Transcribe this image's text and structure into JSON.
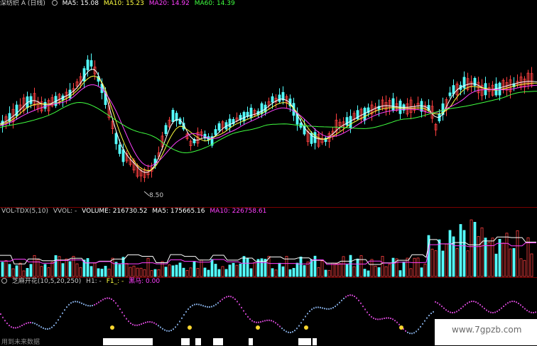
{
  "colors": {
    "up": "#ff4040",
    "down": "#54ffff",
    "ma5": "#ffffff",
    "ma10": "#ffff40",
    "ma20": "#ff40ff",
    "ma60": "#40ff40",
    "sep": "#7a0000"
  },
  "price_header": {
    "title": "深纺织 A (日线)",
    "ma5": "MA5: 15.08",
    "ma10": "MA10: 15.23",
    "ma20": "MA20: 14.92",
    "ma60": "MA60: 14.39"
  },
  "low_label": "8.50",
  "volume_header": {
    "name": "VOL-TDX(5,10)",
    "vvol": "VVOL: -",
    "volume": "VOLUME: 216730.52",
    "ma5": "MA5: 175665.16",
    "ma10": "MA10: 226758.61"
  },
  "indicator_header": {
    "name": "芝麻开花(10,5,20,250)",
    "h1": "H1: -",
    "f1": "F1_: -",
    "heima": "黑马: 0.00"
  },
  "footer_text": "用到未来数据",
  "watermark": "www.7gpzb.com"
}
